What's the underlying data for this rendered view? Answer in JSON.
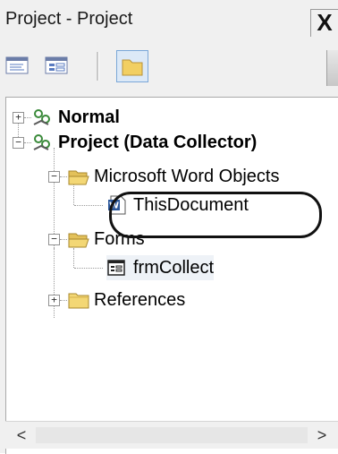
{
  "window": {
    "title": "Project - Project",
    "close_glyph": "X"
  },
  "toolbar": {
    "buttons": [
      "view-code",
      "view-object",
      "toggle-folders"
    ]
  },
  "tree": {
    "nodes": [
      {
        "label": "Normal",
        "icon": "vba-project-icon",
        "expander": "+"
      },
      {
        "label": "Project (Data Collector)",
        "icon": "vba-project-icon",
        "expander": "−"
      },
      {
        "label": "Microsoft Word Objects",
        "icon": "folder-open-icon",
        "expander": "−"
      },
      {
        "label": "ThisDocument",
        "icon": "word-document-icon",
        "highlighted": true
      },
      {
        "label": "Forms",
        "icon": "folder-open-icon",
        "expander": "−"
      },
      {
        "label": "frmCollect",
        "icon": "userform-icon"
      },
      {
        "label": "References",
        "icon": "folder-closed-icon",
        "expander": "+"
      }
    ]
  },
  "scrollbar": {
    "left_glyph": "<",
    "right_glyph": ">"
  },
  "colors": {
    "folder": "#e8c75a",
    "highlight_ring": "#111111",
    "word_blue": "#2b579a"
  }
}
